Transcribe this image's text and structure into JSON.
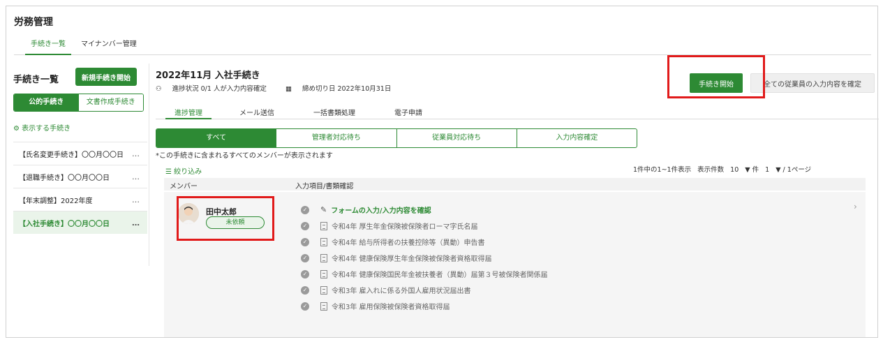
{
  "app": {
    "title": "労務管理"
  },
  "top_tabs": [
    {
      "label": "手続き一覧"
    },
    {
      "label": "マイナンバー管理"
    }
  ],
  "sidebar": {
    "title": "手続き一覧",
    "new_button": "新規手続き開始",
    "segments": [
      {
        "label": "公的手続き"
      },
      {
        "label": "文書作成手続き"
      }
    ],
    "show_procs": "表示する手続き",
    "items": [
      {
        "label": "【氏名変更手続き】〇〇月〇〇日"
      },
      {
        "label": "【退職手続き】〇〇月〇〇日"
      },
      {
        "label": "【年末調整】2022年度"
      },
      {
        "label": "【入社手続き】〇〇月〇〇日"
      }
    ],
    "more": "…"
  },
  "main": {
    "title": "2022年11月 入社手続き",
    "progress": "進捗状況 0/1 人が入力内容確定",
    "deadline": "締め切り日 2022年10月31日",
    "start_button": "手続き開始",
    "confirm_all_button": "全ての従業員の入力内容を確定",
    "sub_tabs": [
      {
        "label": "進捗管理"
      },
      {
        "label": "メール送信"
      },
      {
        "label": "一括書類処理"
      },
      {
        "label": "電子申請"
      }
    ],
    "filters": [
      {
        "label": "すべて"
      },
      {
        "label": "管理者対応待ち"
      },
      {
        "label": "従業員対応待ち"
      },
      {
        "label": "入力内容確定"
      }
    ],
    "note": "*この手続きに含まれるすべてのメンバーが表示されます",
    "filter_link": "絞り込み",
    "pager": {
      "summary": "1件中の1~1件表示",
      "per_page_label": "表示件数",
      "per_page": "10",
      "per_page_unit": "▼ 件",
      "page": "1",
      "page_total": "▼ / 1ページ"
    },
    "table": {
      "col_member": "メンバー",
      "col_items": "入力項目/書類確認",
      "member": {
        "name": "田中太郎",
        "status": "未依頼"
      },
      "form_link": "フォームの入力/入力内容を確認",
      "docs": [
        "令和4年 厚生年金保険被保険者ローマ字氏名届",
        "令和4年 給与所得者の扶養控除等（異動）申告書",
        "令和4年 健康保険厚生年金保険被保険者資格取得届",
        "令和4年 健康保険国民年金被扶養者（異動）届第３号被保険者関係届",
        "令和3年 雇入れに係る外国人雇用状況届出書",
        "令和3年 雇用保険被保険者資格取得届"
      ]
    }
  },
  "colors": {
    "accent": "#2d8a34",
    "highlight": "#e11a1a"
  }
}
